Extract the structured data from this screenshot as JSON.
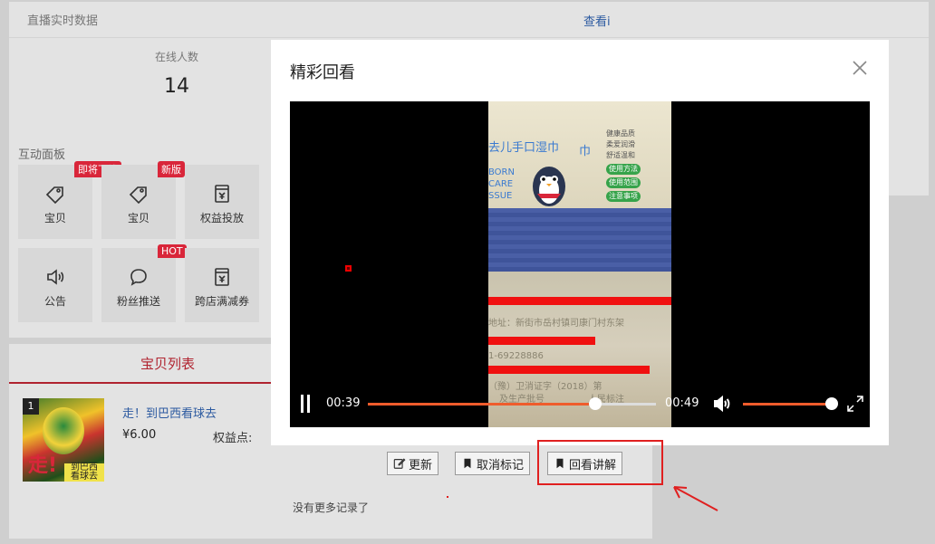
{
  "header": {
    "title": "直播实时数据",
    "view_link": "查看i"
  },
  "stats": {
    "online_label": "在线人数",
    "online_value": "14"
  },
  "interact": {
    "title": "互动面板",
    "tiles": [
      {
        "label": "宝贝",
        "badge": "即将下线",
        "icon": "tag-icon"
      },
      {
        "label": "宝贝",
        "badge": "新版",
        "icon": "tag-icon"
      },
      {
        "label": "权益投放",
        "badge": "",
        "icon": "coupon-box-icon"
      },
      {
        "label": "公告",
        "badge": "",
        "icon": "speaker-icon"
      },
      {
        "label": "粉丝推送",
        "badge": "HOT",
        "icon": "chat-bubble-icon"
      },
      {
        "label": "跨店满减券",
        "badge": "",
        "icon": "coupon-box-icon"
      }
    ]
  },
  "list": {
    "tab_active": "宝贝列表",
    "item": {
      "index": "1",
      "title": "走！到巴西看球去",
      "price": "¥6.00",
      "points_label": "权益点:"
    },
    "buttons": {
      "update": "更新",
      "unmark": "取消标记",
      "replay": "回看讲解"
    },
    "no_more": "没有更多记录了"
  },
  "modal": {
    "title": "精彩回看",
    "video_text": {
      "pack_title": "去儿手口湿巾",
      "pack_sub": [
        "BORN",
        "CARE",
        "SSUE"
      ],
      "checklist": [
        "健康品质",
        "柔爱润滑",
        "舒适温和"
      ],
      "tags": [
        "使用方法",
        "使用范围",
        "注意事项"
      ],
      "address": "地址：新街市岳村镇司康门村东架",
      "phone": "1-69228886",
      "license": "（豫）卫消证字（2018）第",
      "maker": "及生产批号",
      "warn": "人民标注",
      "code": "巾"
    },
    "player": {
      "current_time": "00:39",
      "duration": "00:49",
      "progress": 0.79,
      "volume": 1.0
    }
  },
  "colors": {
    "accent": "#b0232f",
    "badge": "#d9263a",
    "progress": "#ef5c2c",
    "link": "#2c5aa0"
  }
}
